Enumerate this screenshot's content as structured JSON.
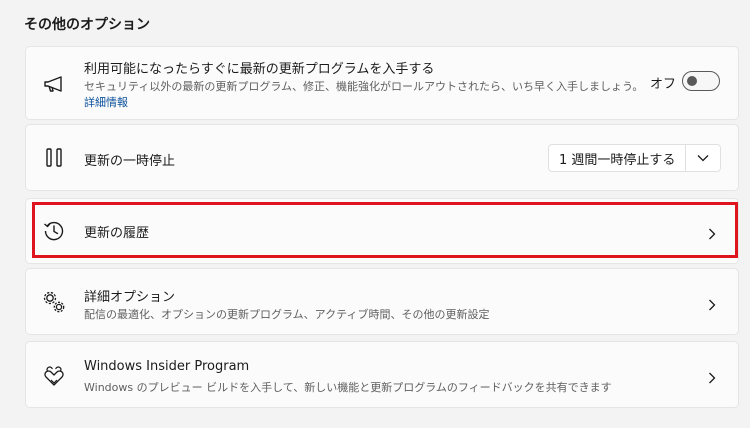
{
  "section": {
    "title": "その他のオプション"
  },
  "cards": {
    "latest_updates": {
      "icon": "megaphone-icon",
      "title": "利用可能になったらすぐに最新の更新プログラムを入手する",
      "description": "セキュリティ以外の最新の更新プログラム、修正、機能強化がロールアウトされたら、いち早く入手しましょう。",
      "link": "詳細情報",
      "toggle_label": "オフ",
      "toggle_state": "off"
    },
    "pause": {
      "icon": "pause-icon",
      "title": "更新の一時停止",
      "dropdown_value": "1 週間一時停止する"
    },
    "history": {
      "icon": "history-icon",
      "title": "更新の履歴"
    },
    "advanced": {
      "icon": "gears-icon",
      "title": "詳細オプション",
      "description": "配信の最適化、オプションの更新プログラム、アクティブ時間、その他の更新設定"
    },
    "insider": {
      "icon": "insider-hearts-icon",
      "title": "Windows Insider Program",
      "description": "Windows のプレビュー ビルドを入手して、新しい機能と更新プログラムのフィードバックを共有できます"
    }
  },
  "colors": {
    "highlight_border": "#e0141e",
    "link": "#0a4f9b",
    "background": "#f3f3f3"
  }
}
